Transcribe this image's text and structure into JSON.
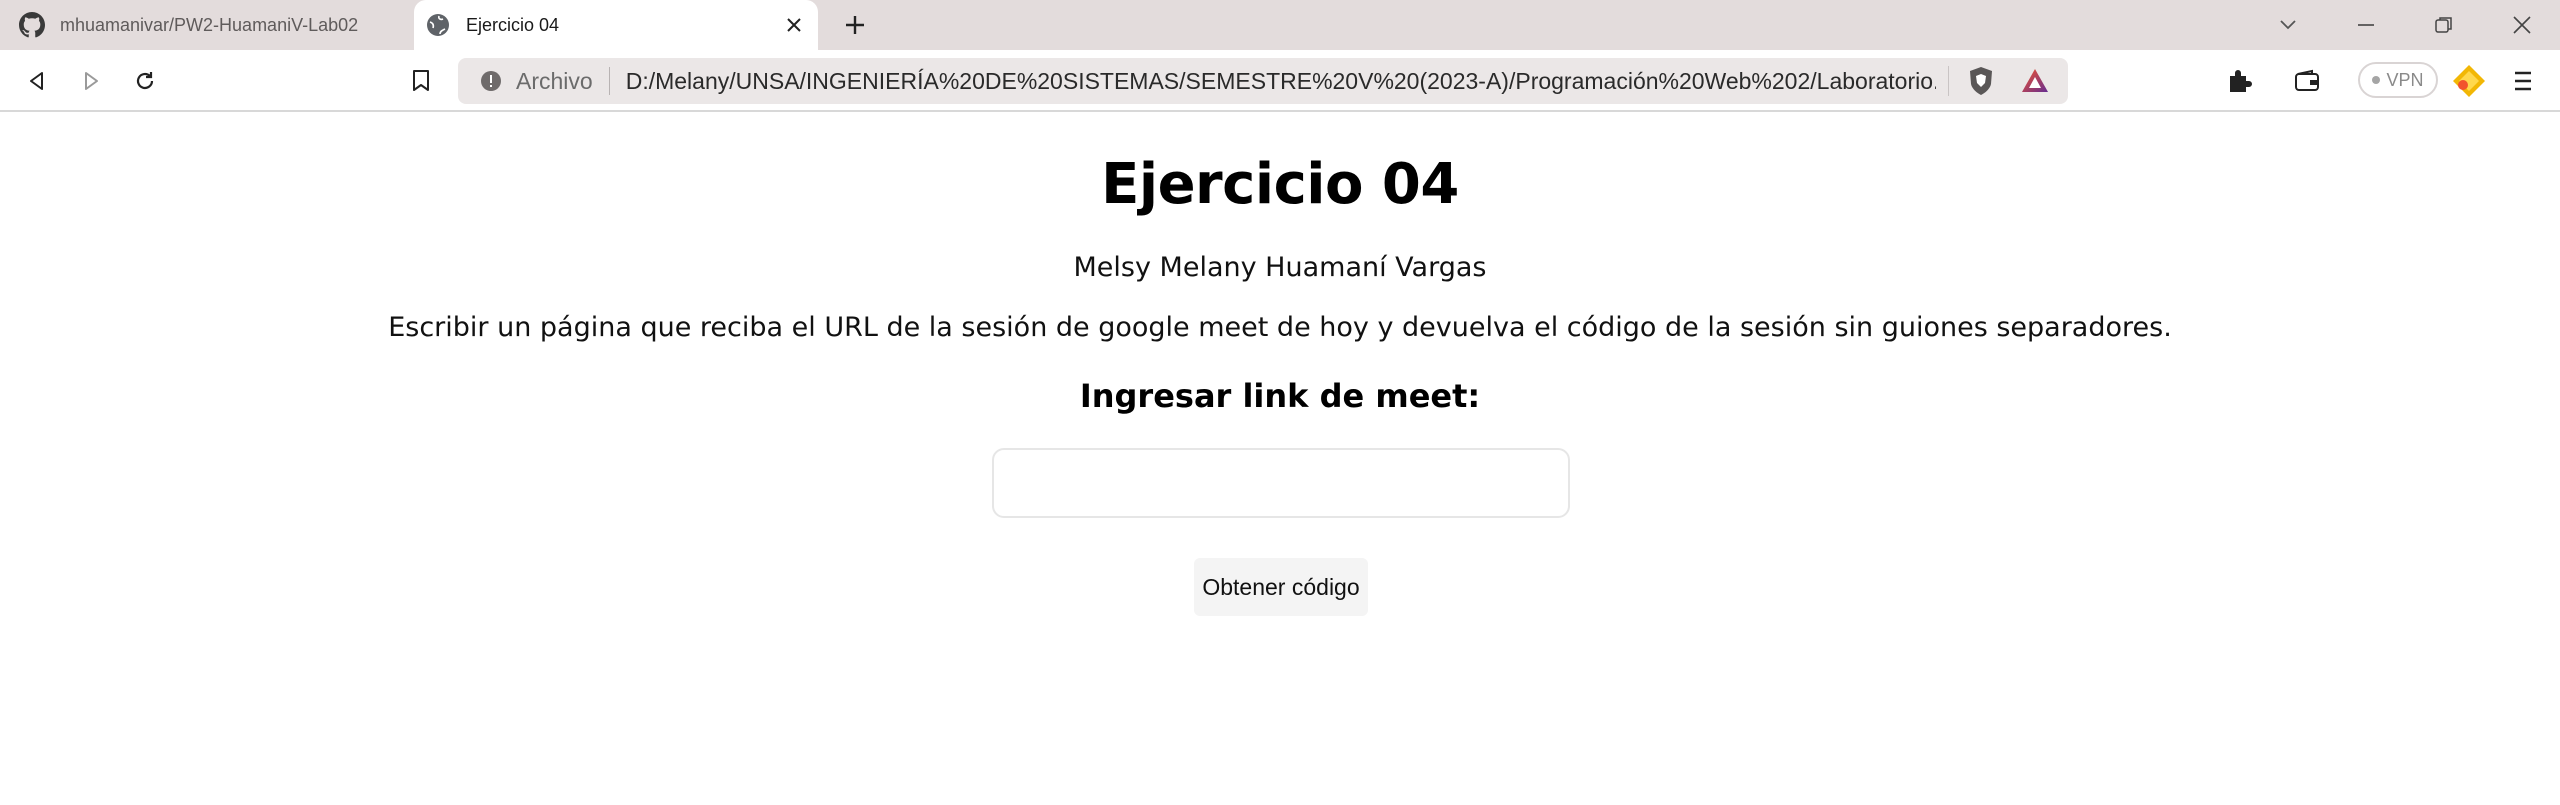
{
  "browser": {
    "tabs": [
      {
        "title": "mhuamanivar/PW2-HuamaniV-Lab02",
        "icon": "github-icon",
        "active": false
      },
      {
        "title": "Ejercicio 04",
        "icon": "globe-icon",
        "active": true
      }
    ],
    "omnibox": {
      "scheme_label": "Archivo",
      "url": "D:/Melany/UNSA/INGENIERÍA%20DE%20SISTEMAS/SEMESTRE%20V%20(2023-A)/Programación%20Web%202/Laboratorio..."
    },
    "vpn_label": "VPN"
  },
  "page": {
    "title": "Ejercicio 04",
    "author": "Melsy Melany Huamaní Vargas",
    "description": "Escribir un página que reciba el URL de la sesión de google meet de hoy y devuelva el código de la sesión sin guiones separadores.",
    "input_heading": "Ingresar link de meet:",
    "input_value": "",
    "button_label": "Obtener código"
  },
  "colors": {
    "tabstrip_bg": "#e3dcdc",
    "omnibox_bg": "#ebe7e7",
    "brave_orange": "#f2542d",
    "rewards_purple": "#662d91"
  }
}
